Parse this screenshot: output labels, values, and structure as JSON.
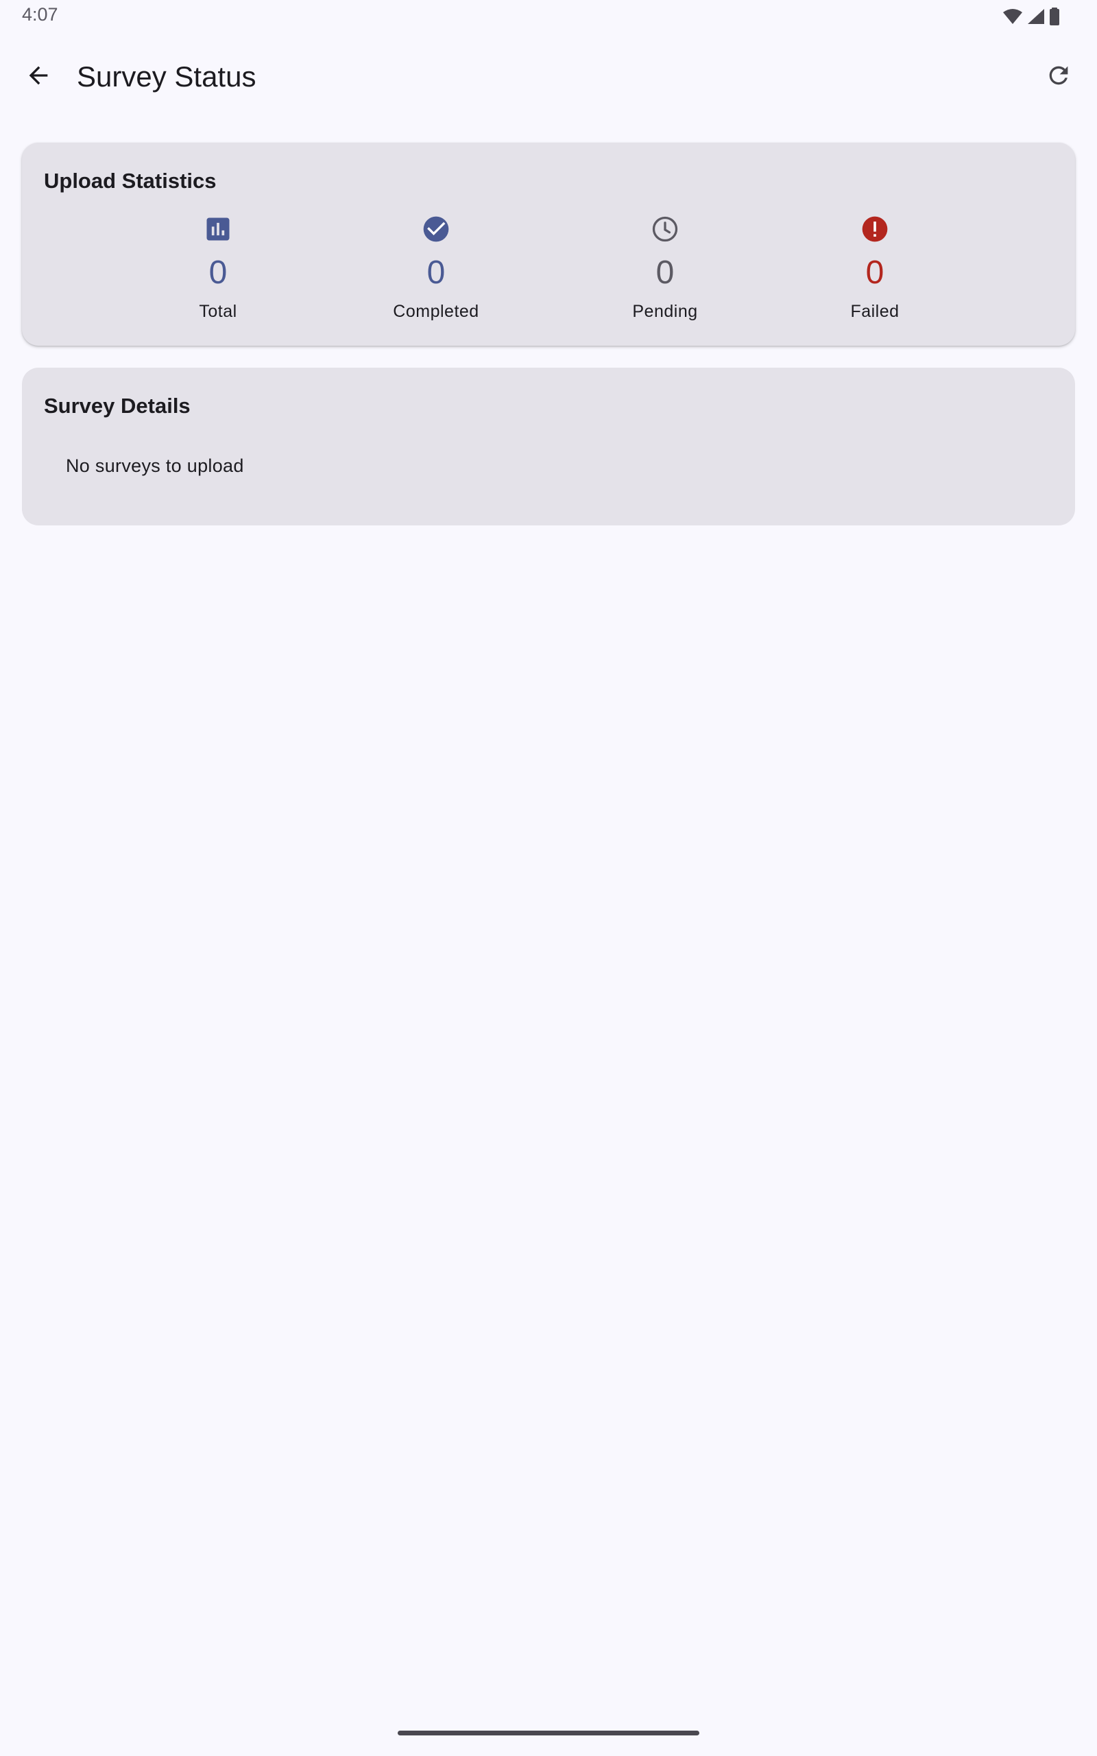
{
  "status_bar": {
    "time": "4:07",
    "icons": [
      "wifi-icon",
      "cell-signal-icon",
      "battery-icon"
    ]
  },
  "app_bar": {
    "title": "Survey Status",
    "back_icon": "arrow-back-icon",
    "refresh_icon": "refresh-icon"
  },
  "upload_statistics": {
    "title": "Upload Statistics",
    "items": [
      {
        "label": "Total",
        "value": "0",
        "icon": "bar-chart-icon",
        "color": "#4a5a94"
      },
      {
        "label": "Completed",
        "value": "0",
        "icon": "check-circle-icon",
        "color": "#4a5a94"
      },
      {
        "label": "Pending",
        "value": "0",
        "icon": "clock-icon",
        "color": "#5c5a63"
      },
      {
        "label": "Failed",
        "value": "0",
        "icon": "error-icon",
        "color": "#b3261e"
      }
    ]
  },
  "survey_details": {
    "title": "Survey Details",
    "empty_message": "No surveys to upload"
  },
  "colors": {
    "background": "#f9f8fe",
    "card": "#e4e2e9",
    "primary": "#4a5a94",
    "error": "#b3261e"
  }
}
